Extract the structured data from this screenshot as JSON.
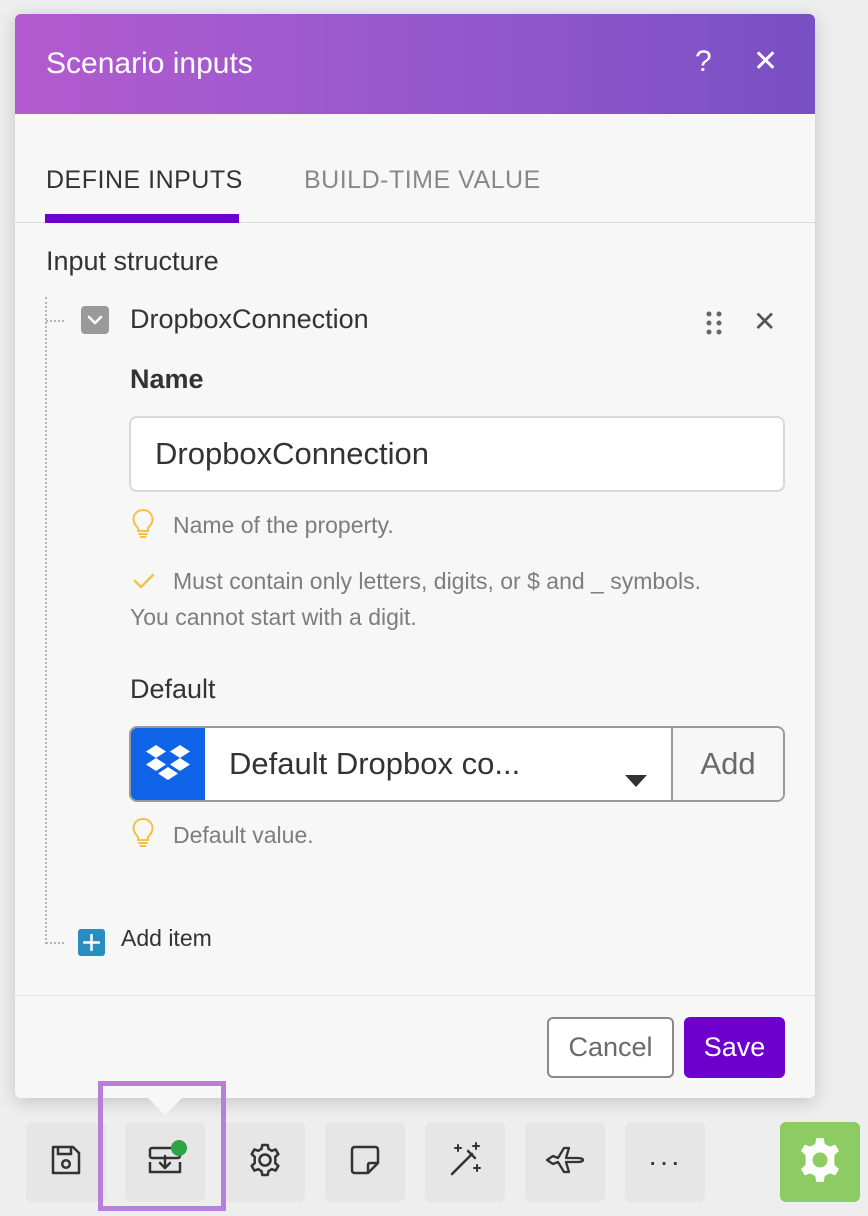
{
  "dialog": {
    "title": "Scenario inputs",
    "help_icon": "question-mark-icon",
    "close_icon": "close-icon",
    "header_gradient": [
      "#b35ad0",
      "#7a4fc4"
    ]
  },
  "tabs": [
    {
      "label": "DEFINE INPUTS",
      "active": true
    },
    {
      "label": "BUILD-TIME VALUE",
      "active": false
    }
  ],
  "input_structure": {
    "label": "Input structure",
    "item": {
      "title": "DropboxConnection",
      "name_label": "Name",
      "name_value": "DropboxConnection",
      "name_hint": "Name of the property.",
      "name_rule_line1": "Must contain only letters, digits, or $ and _ symbols.",
      "name_rule_line2": "You cannot start with a digit.",
      "default_label": "Default",
      "default_value": "Default Dropbox co...",
      "default_add_label": "Add",
      "default_hint": "Default value."
    },
    "add_item_label": "Add item"
  },
  "footer": {
    "cancel_label": "Cancel",
    "save_label": "Save"
  },
  "toolbar": {
    "items": [
      "save-icon",
      "scenario-inputs-icon",
      "settings-icon",
      "notes-icon",
      "magic-wand-icon",
      "airplane-icon",
      "more-icon"
    ],
    "more_label": "···",
    "active_item": "scenario-inputs-icon",
    "status_color": "#2ca444"
  },
  "colors": {
    "accent": "#6d00cc",
    "dropbox": "#0f63e6",
    "add_item": "#2a8dc0",
    "gear_button": "#8ccc62"
  }
}
